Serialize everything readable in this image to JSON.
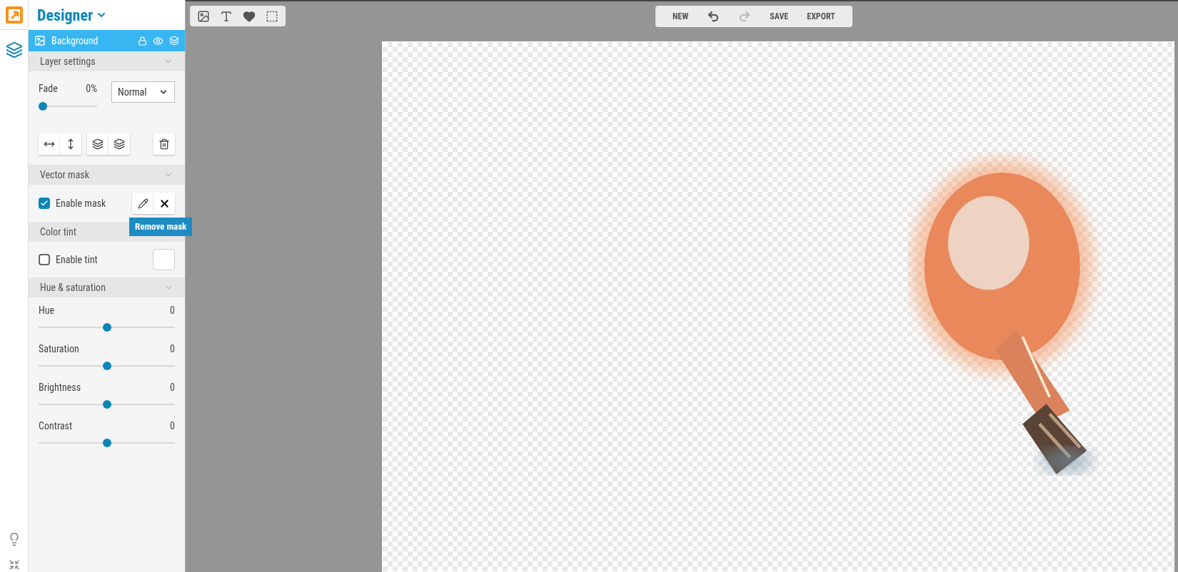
{
  "app": {
    "title": "Designer"
  },
  "layer": {
    "name": "Background",
    "locked": true,
    "visible": true
  },
  "sections": [
    {
      "kind": "layer_settings",
      "title": "Layer settings",
      "fade": {
        "label": "Fade",
        "reading": "0%",
        "level": 0
      },
      "blend_mode": "Normal"
    },
    {
      "kind": "vector_mask",
      "title": "Vector mask",
      "checkbox": {
        "label": "Enable mask",
        "checked": true
      },
      "tooltip": "Remove mask"
    },
    {
      "kind": "color_tint",
      "title": "Color tint",
      "checkbox": {
        "label": "Enable tint",
        "checked": false
      }
    },
    {
      "kind": "hue_saturation",
      "title": "Hue & saturation",
      "sliders": [
        {
          "label": "Hue",
          "reading": "0",
          "level": 0.5
        },
        {
          "label": "Saturation",
          "reading": "0",
          "level": 0.5
        },
        {
          "label": "Brightness",
          "reading": "0",
          "level": 0.5
        },
        {
          "label": "Contrast",
          "reading": "0",
          "level": 0.5
        }
      ]
    }
  ],
  "top_menu": [
    {
      "kind": "text",
      "label": "NEW",
      "disabled": false
    },
    {
      "kind": "undo",
      "disabled": false
    },
    {
      "kind": "redo",
      "disabled": true
    },
    {
      "kind": "text",
      "label": "SAVE",
      "disabled": false
    },
    {
      "kind": "text",
      "label": "EXPORT",
      "disabled": false
    }
  ]
}
